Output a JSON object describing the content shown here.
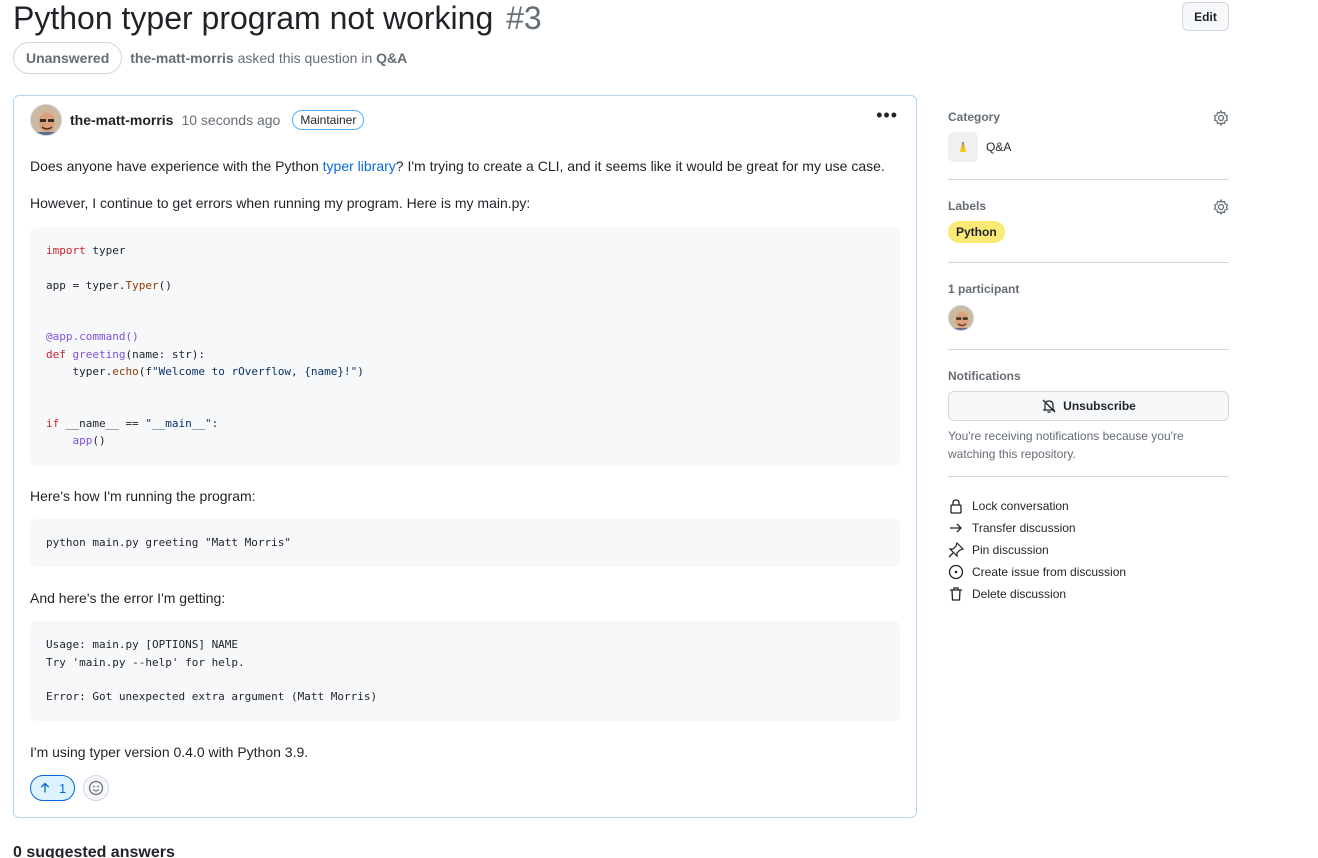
{
  "discussion": {
    "title": "Python typer program not working",
    "number": "#3",
    "edit_label": "Edit",
    "state": "Unanswered",
    "asker": "the-matt-morris",
    "asked_text": "asked this question in",
    "category_link": "Q&A"
  },
  "post": {
    "author": "the-matt-morris",
    "time": "10 seconds ago",
    "role": "Maintainer",
    "para1_before": "Does anyone have experience with the Python ",
    "para1_link": "typer library",
    "para1_after": "? I'm trying to create a CLI, and it seems like it would be great for my use case.",
    "para2": "However, I continue to get errors when running my program. Here is my main.py:",
    "para3": "Here's how I'm running the program:",
    "code2": "python main.py greeting \"Matt Morris\"",
    "para4": "And here's the error I'm getting:",
    "code3_line1": "Usage: main.py [OPTIONS] NAME",
    "code3_line2": "Try 'main.py --help' for help.",
    "code3_line3": "Error: Got unexpected extra argument (Matt Morris)",
    "para5": "I'm using typer version 0.4.0 with Python 3.9.",
    "upvotes": "1"
  },
  "sidebar": {
    "category_heading": "Category",
    "category_value": "Q&A",
    "labels_heading": "Labels",
    "label": "Python",
    "label_color": "#fbe976",
    "participants_heading": "1 participant",
    "notifications_heading": "Notifications",
    "unsubscribe_label": "Unsubscribe",
    "notifications_note": "You're receiving notifications because you're watching this repository.",
    "actions": [
      {
        "label": "Lock conversation",
        "icon": "lock-icon"
      },
      {
        "label": "Transfer discussion",
        "icon": "arrow-right-icon"
      },
      {
        "label": "Pin discussion",
        "icon": "pin-icon"
      },
      {
        "label": "Create issue from discussion",
        "icon": "issue-opened-icon"
      },
      {
        "label": "Delete discussion",
        "icon": "trash-icon"
      }
    ]
  },
  "suggested_answers": "0 suggested answers"
}
